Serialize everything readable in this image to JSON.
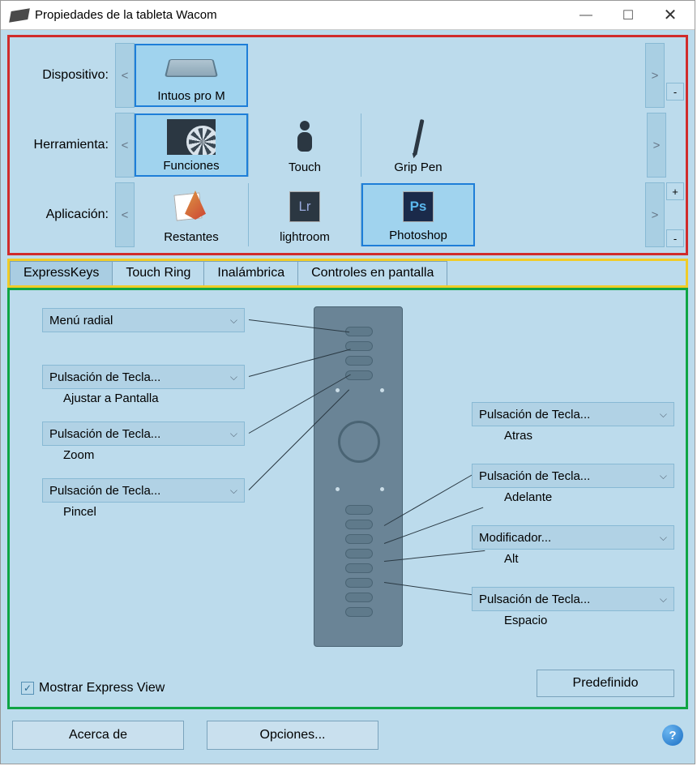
{
  "window": {
    "title": "Propiedades de la tableta Wacom"
  },
  "rows": {
    "device": {
      "label": "Dispositivo:",
      "items": [
        {
          "label": "Intuos pro M"
        }
      ]
    },
    "tool": {
      "label": "Herramienta:",
      "items": [
        {
          "label": "Funciones"
        },
        {
          "label": "Touch"
        },
        {
          "label": "Grip Pen"
        }
      ]
    },
    "app": {
      "label": "Aplicación:",
      "items": [
        {
          "label": "Restantes"
        },
        {
          "label": "lightroom"
        },
        {
          "label": "Photoshop"
        }
      ]
    }
  },
  "navGlyphs": {
    "left": "<",
    "right": ">",
    "plus": "+",
    "minus": "-"
  },
  "tabs": [
    {
      "label": "ExpressKeys"
    },
    {
      "label": "Touch Ring"
    },
    {
      "label": "Inalámbrica"
    },
    {
      "label": "Controles en pantalla"
    }
  ],
  "left": [
    {
      "combo": "Menú radial",
      "sub": ""
    },
    {
      "combo": "Pulsación de Tecla...",
      "sub": "Ajustar a Pantalla"
    },
    {
      "combo": "Pulsación de Tecla...",
      "sub": "Zoom"
    },
    {
      "combo": "Pulsación de Tecla...",
      "sub": "Pincel"
    }
  ],
  "right": [
    {
      "combo": "Pulsación de Tecla...",
      "sub": "Atras"
    },
    {
      "combo": "Pulsación de Tecla...",
      "sub": "Adelante"
    },
    {
      "combo": "Modificador...",
      "sub": "Alt"
    },
    {
      "combo": "Pulsación de Tecla...",
      "sub": "Espacio"
    }
  ],
  "checkbox": {
    "label": "Mostrar Express View",
    "checked": true
  },
  "defaultBtn": "Predefinido",
  "footer": {
    "about": "Acerca de",
    "options": "Opciones..."
  },
  "iconText": {
    "lr": "Lr",
    "ps": "Ps",
    "help": "?",
    "check": "✓"
  }
}
